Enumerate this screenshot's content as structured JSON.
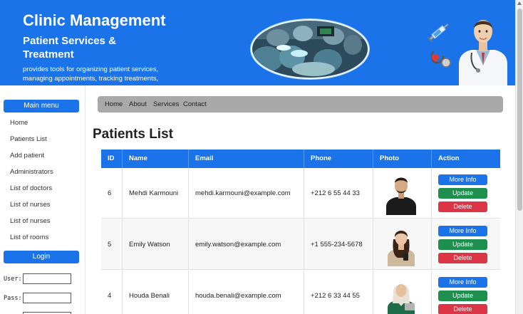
{
  "header": {
    "title": "Clinic Management",
    "subtitle": "Patient Services & Treatment",
    "description": "provides tools for organizing patient services, managing appointments, tracking treatments,"
  },
  "sidebar": {
    "main_menu_label": "Main menu",
    "items": [
      {
        "label": "Home"
      },
      {
        "label": "Patients List"
      },
      {
        "label": "Add patient"
      },
      {
        "label": "Administrators"
      },
      {
        "label": "List of doctors"
      },
      {
        "label": "List of nurses"
      },
      {
        "label": "List of nurses"
      },
      {
        "label": "List of rooms"
      }
    ],
    "login_label": "Login",
    "user_label": "User:",
    "pass_label": "Pass:"
  },
  "navbar": {
    "items": [
      {
        "label": "Home"
      },
      {
        "label": "About"
      },
      {
        "label": "Services"
      },
      {
        "label": "Contact"
      }
    ]
  },
  "main": {
    "page_title": "Patients List"
  },
  "table": {
    "headers": [
      "ID",
      "Name",
      "Email",
      "Phone",
      "Photo",
      "Action"
    ],
    "rows": [
      {
        "id": "6",
        "name": "Mehdi Karmouni",
        "email": "mehdi.karmouni@example.com",
        "phone": "+212 6 55 44 33"
      },
      {
        "id": "5",
        "name": "Emily Watson",
        "email": "emily.watson@example.com",
        "phone": "+1 555-234-5678"
      },
      {
        "id": "4",
        "name": "Houda Benali",
        "email": "houda.benali@example.com",
        "phone": "+212 6 33 44 55"
      }
    ],
    "actions": {
      "info": "More Info",
      "update": "Update",
      "delete": "Delete"
    }
  },
  "colors": {
    "primary": "#1a73e8",
    "success": "#1e8f4e",
    "danger": "#dc3545",
    "navbar": "#a9a9a9"
  }
}
